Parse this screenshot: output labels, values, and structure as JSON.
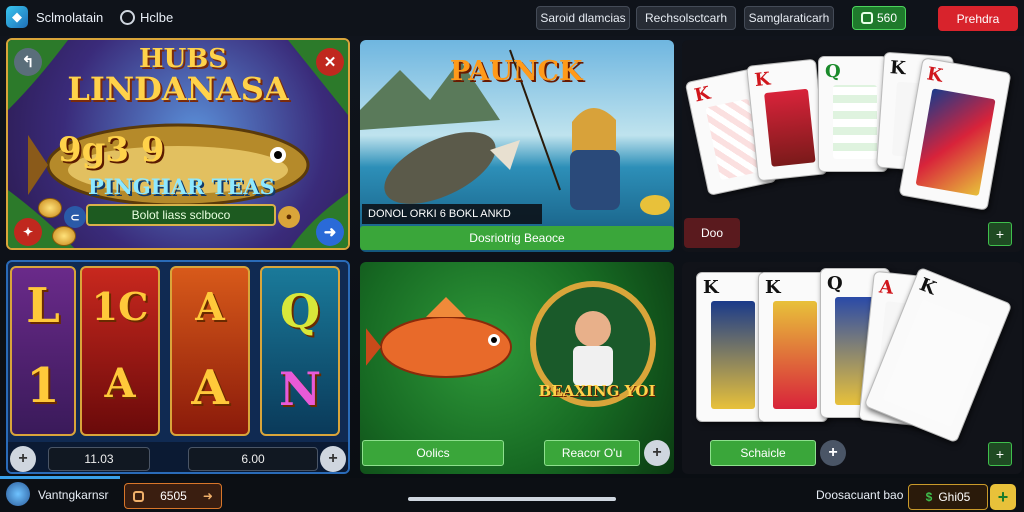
{
  "header": {
    "brand": "Sclmolatain",
    "hub": "Hclbe",
    "tabs": [
      "Saroid dlamcias",
      "Rechsolsctcarh",
      "Samglaraticarh"
    ],
    "coins": "560",
    "primary": "Prehdra"
  },
  "tiles": {
    "t1": {
      "title_top": "HUBS",
      "title_main": "LINDANASA",
      "numbers": "9g3 9",
      "subtitle": "PINGHAR TEAS",
      "bar": "Bolot liass sclboco"
    },
    "t2": {
      "title": "PAUNCK",
      "caption": "DONOL ORKI 6 BOKL ANKD",
      "button": "Dosriotrig Beaoce"
    },
    "t3": {
      "badge": "Doo",
      "cards": [
        "K",
        "K",
        "Q",
        "K",
        "K"
      ]
    },
    "t4": {
      "reels": [
        [
          "L",
          "1"
        ],
        [
          "1C",
          "A"
        ],
        [
          "A",
          "A"
        ],
        [
          "Q",
          "N"
        ]
      ],
      "bet": "11.03",
      "win": "6.00"
    },
    "t5": {
      "label": "BEAXING YOI",
      "left_button": "Oolics",
      "right_button": "Reacor O'u"
    },
    "t6": {
      "button": "Schaicle",
      "cards": [
        "K",
        "K",
        "Q",
        "A",
        "K"
      ]
    }
  },
  "footer": {
    "username": "Vantngkarnsr",
    "coins": "6505",
    "status": "Doosacuant bao",
    "balance": "Ghi05"
  },
  "colors": {
    "accent_red": "#d8232c",
    "accent_green": "#3aa63a",
    "gold": "#ffd24a"
  }
}
